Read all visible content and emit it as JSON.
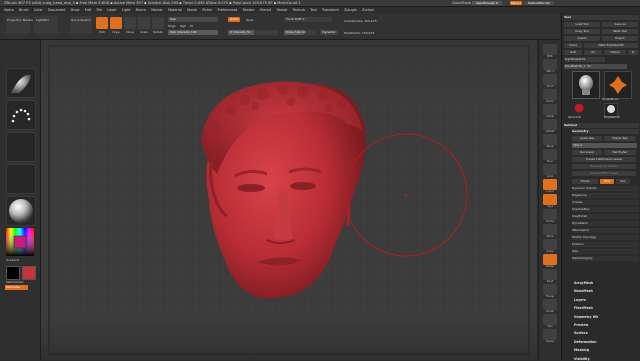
{
  "titlebar": {
    "title": "ZBrush 4R7 P3 (x64)   craig_head_dna_3   ▪ Free Mem 9.6GB ▪ Active Mem 397 ▪ Scratch Disk 293 ▪ Timer 0.039 ATime 0.079 ▪ PolyCount 159,675 KP ▪ MeshCount 1",
    "quicksave": "QuickSave",
    "see_through": "See-through   0",
    "menus": "Menus",
    "default_script": "DefaultZScript"
  },
  "menubar": [
    "Alpha",
    "Brush",
    "Color",
    "Document",
    "Draw",
    "Edit",
    "File",
    "Layer",
    "Light",
    "Macro",
    "Marker",
    "Material",
    "Movie",
    "Picker",
    "Preferences",
    "Render",
    "Stencil",
    "Stroke",
    "Texture",
    "Tool",
    "Transform",
    "Zplugin",
    "Zscript"
  ],
  "toolbar": {
    "projection_master": "Projection Master",
    "lightbox": "LightBox",
    "quick_sketch": "Quick Sketch",
    "edit": "Edit",
    "draw": "Draw",
    "move": "Move",
    "scale": "Scale",
    "rotate": "Rotate",
    "mrgb": "Mrgb",
    "rgb": "Rgb",
    "m": "M",
    "zadd": "Zadd",
    "zsub": "Zsub",
    "zcut": "Zcut",
    "rgb_intensity": "Rgb Intensity 100",
    "z_intensity": "Z Intensity 51",
    "focal_shift": "Focal Shift 0",
    "draw_size": "Draw Size 64",
    "dynamic": "Dynamic",
    "active_points": "ActivePoints: 159,675",
    "total_points": "TotalPoints: 159,675"
  },
  "leftshelf": {
    "gradient": "Gradient",
    "switch_color": "SwitchColor",
    "alternate": "Alternate"
  },
  "rightstrip": [
    "BPR",
    "SPix 3",
    "Scroll",
    "Zoom",
    "Actual",
    "AAHalf",
    "Persp",
    "Floor",
    "Local",
    "L.Sym",
    "Gxyz",
    "Frame",
    "Move",
    "Scale",
    "Rotate",
    "PolyF",
    "Transp",
    "Ghost",
    "Solo",
    "Xpose"
  ],
  "tray": {
    "title": "Tool",
    "load_tool": "Load Tool",
    "save_as": "Save As",
    "copy_tool": "Copy Tool",
    "paste_tool": "Paste Tool",
    "import": "Import",
    "export": "Export",
    "clone": "Clone",
    "make_polymesh": "Make PolyMesh3D",
    "goz": "GoZ",
    "all": "All",
    "visible": "Visible",
    "r": "R",
    "lightbox_tools": "Lightbox▸Tools",
    "current_tool": "PolyMesh3D_1. 30",
    "thumb_labels": [
      "PolyMesh3D",
      "SimpleBrush",
      "Sphere3D",
      "PolyMesh3D"
    ],
    "subtool": "Subtool",
    "geometry": "Geometry",
    "lower_res": "Lower Res",
    "higher_res": "Higher Res",
    "sdiv": "SDiv 2",
    "del_lower": "Del Lower",
    "del_higher": "Del Higher",
    "freeze_subdiv": "Freeze SubDivision Levels",
    "reconstruct_subdiv": "Reconstruct Subdiv",
    "convert_bpr": "Convert BPR To Geo",
    "divide": "Divide",
    "smt": "Smt",
    "suv": "Suv",
    "sections": [
      "Dynamic Subdiv",
      "EdgeLoop",
      "Crease",
      "ShadowBox",
      "ClayPolish",
      "DynaMesh",
      "ZRemesher",
      "Modify Topology",
      "Position",
      "Size",
      "MeshIntegrity"
    ],
    "bottom_sections": [
      "ArrayMesh",
      "NanoMesh",
      "Layers",
      "FiberMesh",
      "Geometry HD",
      "Preview",
      "Surface",
      "Deformation",
      "Masking",
      "Visibility"
    ]
  },
  "colors": {
    "accent": "#e0701e",
    "model": "#c8323a",
    "viewport_bg": "#3c3c3c",
    "grid": "#474747",
    "cursor_ring": "#b0201e"
  }
}
